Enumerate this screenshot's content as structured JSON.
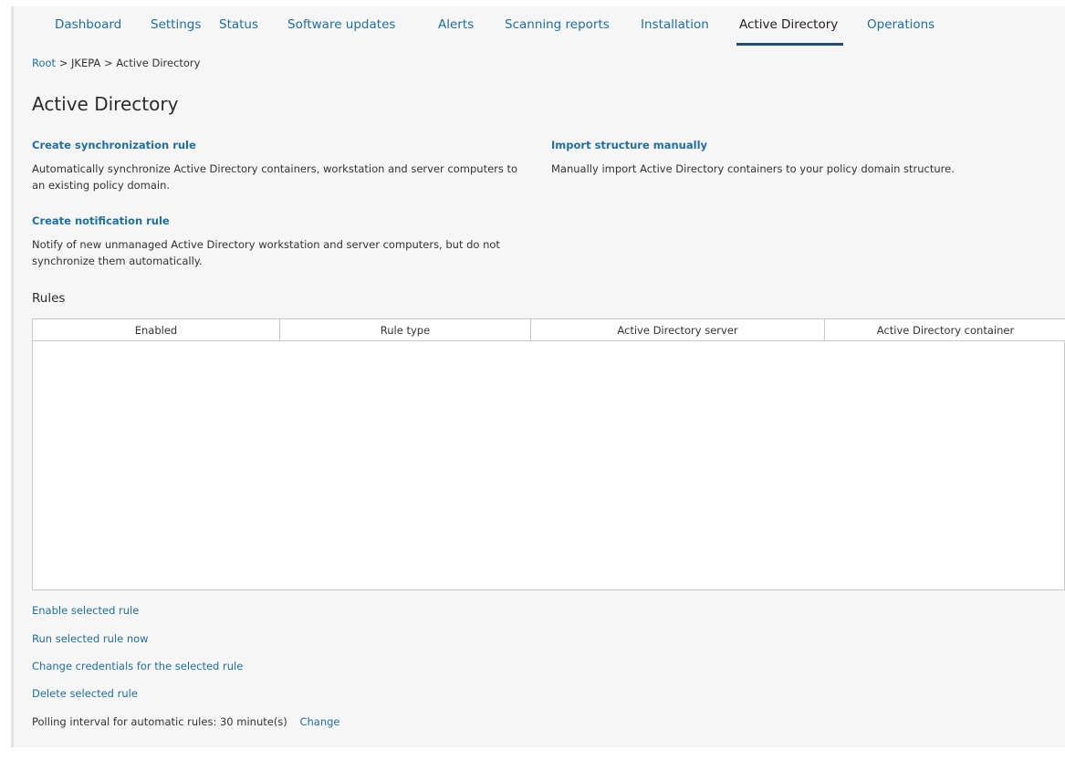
{
  "tabs": [
    {
      "label": "Dashboard"
    },
    {
      "label": "Settings"
    },
    {
      "label": "Status"
    },
    {
      "label": "Software updates"
    },
    {
      "label": "Alerts"
    },
    {
      "label": "Scanning reports"
    },
    {
      "label": "Installation"
    },
    {
      "label": "Active Directory",
      "active": true
    },
    {
      "label": "Operations"
    }
  ],
  "breadcrumb": {
    "items": [
      "Root",
      "JKEPA",
      "Active Directory"
    ],
    "separator": ">"
  },
  "page": {
    "title": "Active Directory"
  },
  "actions": {
    "sync_rule": {
      "label": "Create synchronization rule",
      "description": "Automatically synchronize Active Directory containers, workstation and server computers to an existing policy domain."
    },
    "notification_rule": {
      "label": "Create notification rule",
      "description": "Notify of new unmanaged Active Directory workstation and server computers, but do not synchronize them automatically."
    },
    "import_manual": {
      "label": "Import structure manually",
      "description": "Manually import Active Directory containers to your policy domain structure."
    }
  },
  "rules": {
    "title": "Rules",
    "columns": [
      "Enabled",
      "Rule type",
      "Active Directory server",
      "Active Directory container"
    ],
    "rows": []
  },
  "rule_actions": {
    "enable": "Enable selected rule",
    "run": "Run selected rule now",
    "credentials": "Change credentials for the selected rule",
    "delete": "Delete selected rule"
  },
  "polling": {
    "text": "Polling interval for automatic rules: 30 minute(s)",
    "change_label": "Change"
  },
  "colors": {
    "link": "#1f6fa3",
    "active_tab_underline": "#1f4e79",
    "panel_background": "#f6f6f6"
  }
}
